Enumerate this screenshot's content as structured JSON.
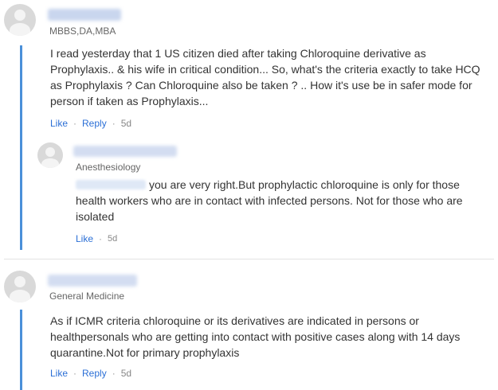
{
  "comments": [
    {
      "specialty": "MBBS,DA,MBA",
      "text": "I read yesterday that 1 US citizen died after taking Chloroquine derivative as Prophylaxis.. & his wife in critical condition... So, what's the criteria exactly to take HCQ as Prophylaxis ? Can Chloroquine also be taken ? .. How it's use be in safer mode for person if taken as Prophylaxis...",
      "actions": {
        "like": "Like",
        "reply": "Reply",
        "age": "5d"
      },
      "reply": {
        "specialty": "Anesthesiology",
        "text": "you are very right.But prophylactic chloroquine is only for those health workers who are in contact with infected persons. Not for those who are isolated",
        "actions": {
          "like": "Like",
          "age": "5d"
        }
      }
    },
    {
      "specialty": "General Medicine",
      "text": "As if ICMR criteria chloroquine or its derivatives are indicated in persons or healthpersonals who are getting into contact with positive cases along with 14 days quarantine.Not for primary prophylaxis",
      "actions": {
        "like": "Like",
        "reply": "Reply",
        "age": "5d"
      }
    }
  ],
  "separator": "·",
  "colors": {
    "accent_link": "#2b6fd6",
    "thread_line": "#4a90d9",
    "avatar": "#d9d9d9",
    "blurred_name": "#c9d6ee"
  }
}
